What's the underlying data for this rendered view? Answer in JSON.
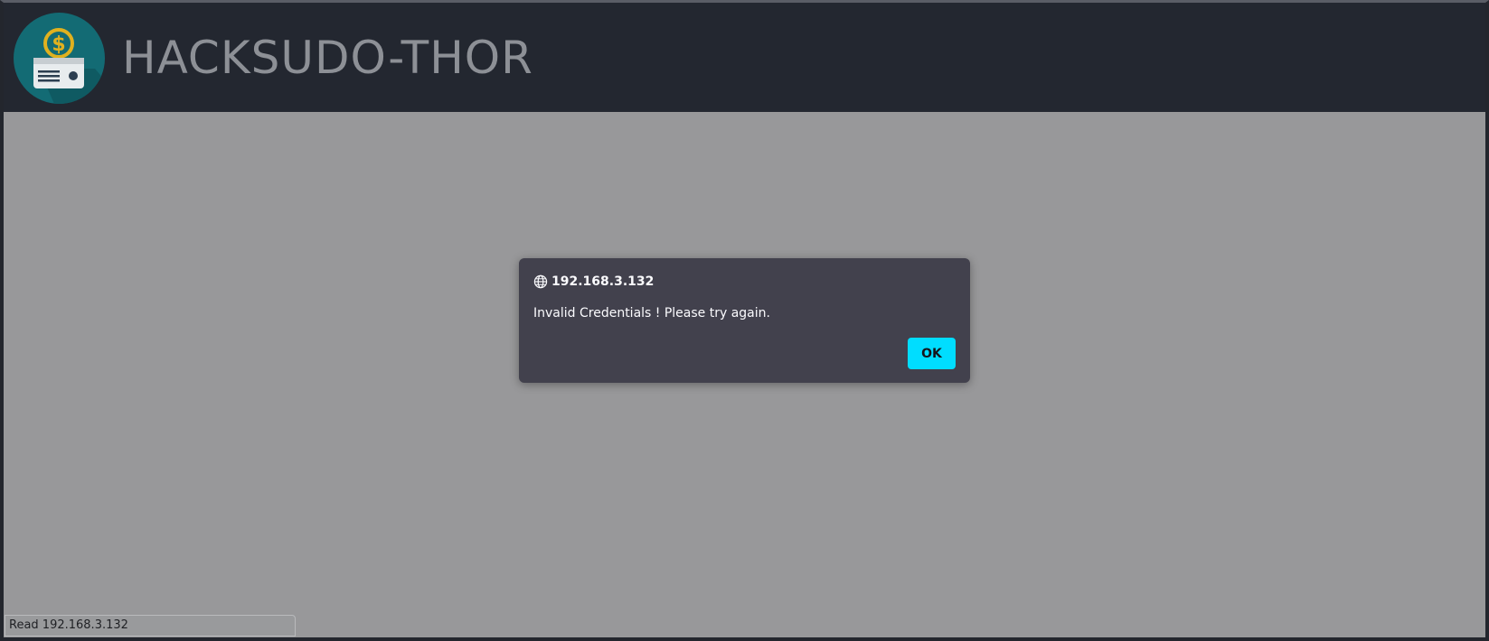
{
  "site": {
    "brand_title": "HACKSUDO-THOR",
    "logo_icon": "money-card-icon",
    "logo_symbol": "$"
  },
  "dialog": {
    "origin": "192.168.3.132",
    "origin_icon": "globe-icon",
    "message": "Invalid Credentials ! Please try again.",
    "ok_label": "OK"
  },
  "status_bar": {
    "text": "Read 192.168.3.132"
  },
  "colors": {
    "header_bg": "#232730",
    "dialog_bg": "#42414d",
    "accent_button": "#00ddff",
    "logo_circle": "#136b74",
    "logo_coin": "#e0b11f"
  }
}
